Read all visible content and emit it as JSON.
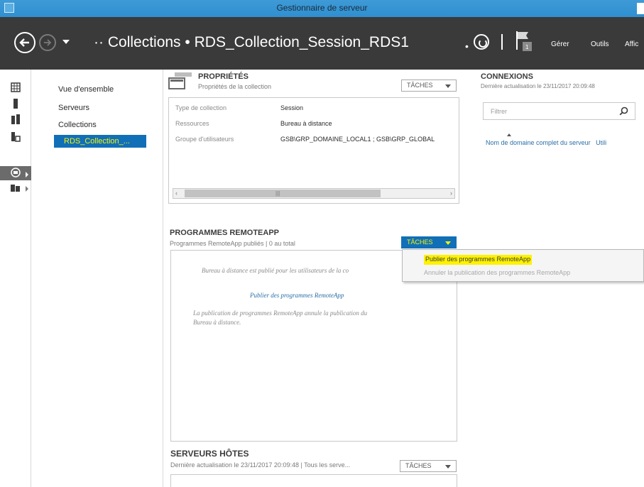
{
  "window": {
    "title": "Gestionnaire de serveur"
  },
  "navbar": {
    "breadcrumb_prefix": "··",
    "crumb_1": "Collections",
    "separator": "•",
    "crumb_2": "RDS_Collection_Session_RDS1",
    "menu_manage": "Gérer",
    "menu_tools": "Outils",
    "menu_view": "Affic"
  },
  "sidenav": {
    "items": [
      {
        "label": "Vue d'ensemble"
      },
      {
        "label": "Serveurs"
      },
      {
        "label": "Collections"
      }
    ],
    "selected": "RDS_Collection_..."
  },
  "properties": {
    "title": "PROPRIÉTÉS",
    "subtitle": "Propriétés de la collection",
    "tasks_label": "TÂCHES",
    "rows": [
      {
        "key": "Type de collection",
        "value": "Session"
      },
      {
        "key": "Ressources",
        "value": "Bureau à distance"
      },
      {
        "key": "Groupe d'utilisateurs",
        "value": "GSB\\GRP_DOMAINE_LOCAL1 ; GSB\\GRP_GLOBAL"
      }
    ]
  },
  "remoteapp": {
    "title": "PROGRAMMES REMOTEAPP",
    "subtitle": "Programmes RemoteApp publiés | 0 au total",
    "tasks_label": "TÂCHES",
    "msg_1": "Bureau à distance est publié pour les utilisateurs de la co",
    "link": "Publier des programmes RemoteApp",
    "msg_2_line1": "La publication de programmes RemoteApp annule la publication du",
    "msg_2_line2": "Bureau à distance."
  },
  "dropdown": {
    "item_1": "Publier des programmes RemoteApp",
    "item_2": "Annuler la publication des programmes RemoteApp"
  },
  "hosts": {
    "title": "SERVEURS HÔTES",
    "subtitle": "Dernière actualisation le 23/11/2017 20:09:48 | Tous les serve...",
    "tasks_label": "TÂCHES"
  },
  "connections": {
    "title": "CONNEXIONS",
    "subtitle": "Dernière actualisation le 23/11/2017 20:09:48",
    "filter_placeholder": "Filtrer",
    "column_1": "Nom de domaine complet du serveur",
    "column_2": "Utili"
  },
  "colors": {
    "navbar_bg": "#3a3a3a",
    "titlebar_bg": "#3f9ad6",
    "selection_bg": "#116fb8",
    "selection_text": "#f5f500",
    "highlight": "#fff200",
    "link": "#2a6fa8"
  }
}
